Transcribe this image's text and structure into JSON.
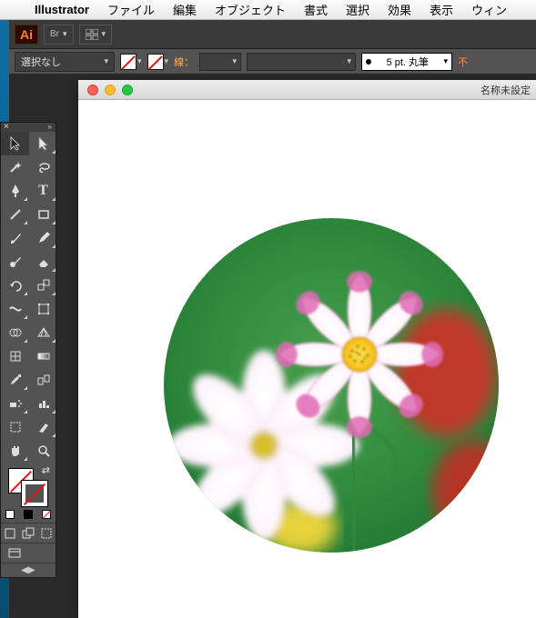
{
  "menubar": {
    "app": "Illustrator",
    "items": [
      "ファイル",
      "編集",
      "オブジェクト",
      "書式",
      "選択",
      "効果",
      "表示",
      "ウィン"
    ]
  },
  "chrome": {
    "logo": "Ai",
    "bridge": "Br"
  },
  "ctrl": {
    "noselection": "選択なし",
    "stroke_label": "線：",
    "stroke_weight": "",
    "brush_label": "5 pt. 丸筆",
    "opacity_label": "不"
  },
  "document": {
    "title": "名称未設定"
  },
  "tools": {
    "names": [
      "selection-tool",
      "direct-selection-tool",
      "magic-wand-tool",
      "lasso-tool",
      "pen-tool",
      "type-tool",
      "line-tool",
      "rectangle-tool",
      "paintbrush-tool",
      "pencil-tool",
      "blob-brush-tool",
      "eraser-tool",
      "rotate-tool",
      "scale-tool",
      "width-tool",
      "free-transform-tool",
      "shape-builder-tool",
      "perspective-grid-tool",
      "mesh-tool",
      "gradient-tool",
      "eyedropper-tool",
      "blend-tool",
      "symbol-sprayer-tool",
      "column-graph-tool",
      "artboard-tool",
      "slice-tool",
      "hand-tool",
      "zoom-tool"
    ]
  }
}
